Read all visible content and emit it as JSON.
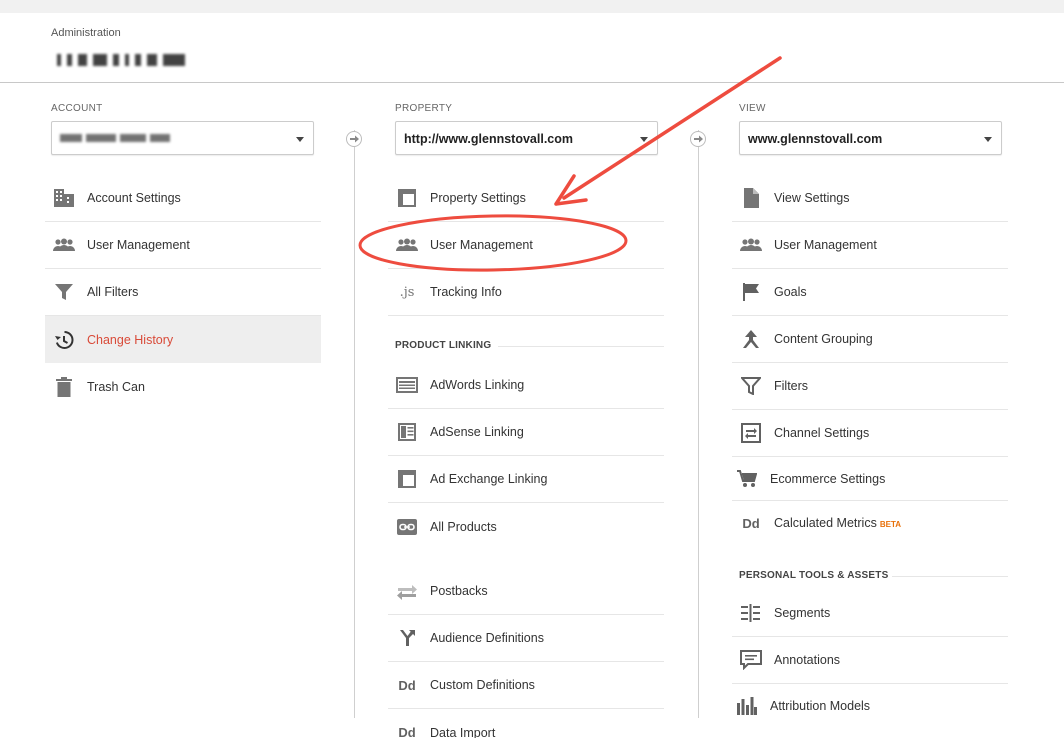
{
  "header": {
    "title": "Administration"
  },
  "account": {
    "label": "ACCOUNT",
    "items": [
      {
        "label": "Account Settings",
        "icon": "building-icon"
      },
      {
        "label": "User Management",
        "icon": "users-icon"
      },
      {
        "label": "All Filters",
        "icon": "filter-icon"
      },
      {
        "label": "Change History",
        "icon": "history-icon",
        "active": true
      },
      {
        "label": "Trash Can",
        "icon": "trash-icon"
      }
    ]
  },
  "property": {
    "label": "PROPERTY",
    "selected": "http://www.glennstovall.com",
    "items": [
      {
        "label": "Property Settings",
        "icon": "window-icon"
      },
      {
        "label": "User Management",
        "icon": "users-icon"
      },
      {
        "label": "Tracking Info",
        "icon": "js-icon",
        "glyph": ".js"
      }
    ],
    "product_linking_heading": "PRODUCT LINKING",
    "linking_items": [
      {
        "label": "AdWords Linking",
        "icon": "adwords-icon"
      },
      {
        "label": "AdSense Linking",
        "icon": "adsense-icon"
      },
      {
        "label": "Ad Exchange Linking",
        "icon": "window-icon"
      },
      {
        "label": "All Products",
        "icon": "link-icon"
      }
    ],
    "other_items": [
      {
        "label": "Postbacks",
        "icon": "postbacks-icon"
      },
      {
        "label": "Audience Definitions",
        "icon": "fork-icon"
      },
      {
        "label": "Custom Definitions",
        "icon": "dd-icon",
        "glyph": "Dd"
      },
      {
        "label": "Data Import",
        "icon": "dd-icon",
        "glyph": "Dd"
      }
    ]
  },
  "view": {
    "label": "VIEW",
    "selected": "www.glennstovall.com",
    "items": [
      {
        "label": "View Settings",
        "icon": "document-icon"
      },
      {
        "label": "User Management",
        "icon": "users-icon"
      },
      {
        "label": "Goals",
        "icon": "flag-icon"
      },
      {
        "label": "Content Grouping",
        "icon": "grouping-icon"
      },
      {
        "label": "Filters",
        "icon": "filter-icon"
      },
      {
        "label": "Channel Settings",
        "icon": "channel-icon"
      },
      {
        "label": "Ecommerce Settings",
        "icon": "cart-icon"
      },
      {
        "label": "Calculated Metrics",
        "icon": "dd-icon",
        "glyph": "Dd",
        "badge": "BETA"
      }
    ],
    "personal_heading": "PERSONAL TOOLS & ASSETS",
    "personal_items": [
      {
        "label": "Segments",
        "icon": "segments-icon"
      },
      {
        "label": "Annotations",
        "icon": "comment-icon"
      },
      {
        "label": "Attribution Models",
        "icon": "bars-icon"
      }
    ]
  },
  "colors": {
    "active_text": "#d94a38",
    "annotation": "#ee4c3f",
    "beta": "#e8710a"
  }
}
